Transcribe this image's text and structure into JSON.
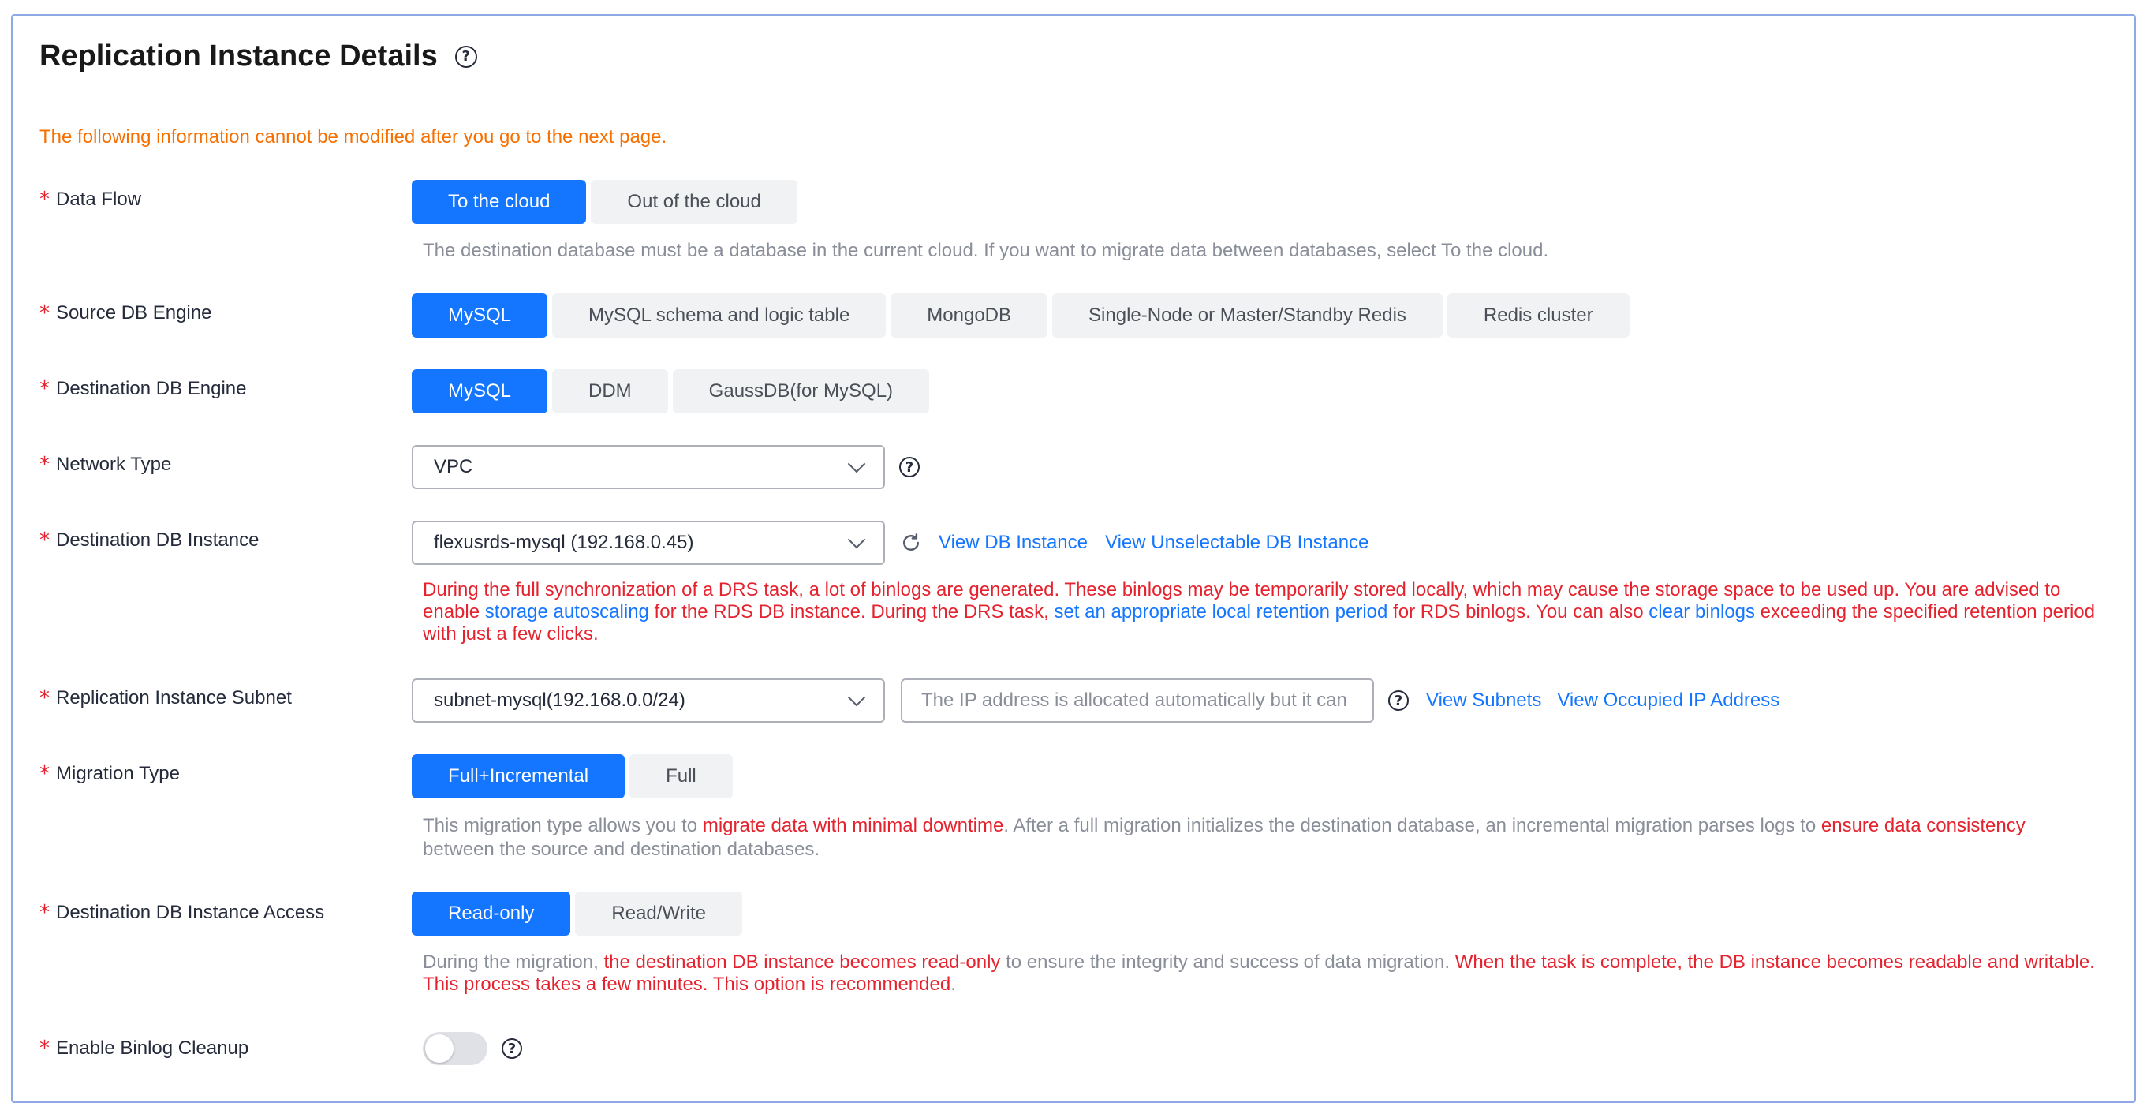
{
  "page": {
    "title": "Replication Instance Details",
    "notice": "The following information cannot be modified after you go to the next page."
  },
  "data_flow": {
    "label": "Data Flow",
    "options": [
      "To the cloud",
      "Out of the cloud"
    ],
    "selected": "To the cloud",
    "help": "The destination database must be a database in the current cloud. If you want to migrate data between databases, select To the cloud."
  },
  "source_engine": {
    "label": "Source DB Engine",
    "options": [
      "MySQL",
      "MySQL schema and logic table",
      "MongoDB",
      "Single-Node or Master/Standby Redis",
      "Redis cluster"
    ],
    "selected": "MySQL"
  },
  "dest_engine": {
    "label": "Destination DB Engine",
    "options": [
      "MySQL",
      "DDM",
      "GaussDB(for MySQL)"
    ],
    "selected": "MySQL"
  },
  "network_type": {
    "label": "Network Type",
    "value": "VPC"
  },
  "dest_instance": {
    "label": "Destination DB Instance",
    "value": "flexusrds-mysql (192.168.0.45)",
    "link_view": "View DB Instance",
    "link_unselectable": "View Unselectable DB Instance",
    "warning_1": "During the full synchronization of a DRS task, a lot of binlogs are generated. These binlogs may be temporarily stored locally, which may cause the storage space to be used up. You are advised to enable ",
    "warning_link_1": "storage autoscaling",
    "warning_2": " for the RDS DB instance. During the DRS task, ",
    "warning_link_2": "set an appropriate local retention period",
    "warning_3": " for RDS binlogs. You can also ",
    "warning_link_3": "clear binlogs",
    "warning_4": " exceeding the specified retention period with just a few clicks."
  },
  "subnet": {
    "label": "Replication Instance Subnet",
    "value": "subnet-mysql(192.168.0.0/24)",
    "ip_placeholder": "The IP address is allocated automatically but it can",
    "link_subnets": "View Subnets",
    "link_occupied": "View Occupied IP Address"
  },
  "migration_type": {
    "label": "Migration Type",
    "options": [
      "Full+Incremental",
      "Full"
    ],
    "selected": "Full+Incremental",
    "help_1": "This migration type allows you to ",
    "help_red_1": "migrate data with minimal downtime",
    "help_2": ". After a full migration initializes the destination database, an incremental migration parses logs to ",
    "help_red_2": "ensure data consistency",
    "help_3": "between the source and destination databases."
  },
  "dest_access": {
    "label": "Destination DB Instance Access",
    "options": [
      "Read-only",
      "Read/Write"
    ],
    "selected": "Read-only",
    "help_1": "During the migration, ",
    "help_red_1": "the destination DB instance becomes read-only",
    "help_2": " to ensure the integrity and success of data migration. ",
    "help_red_2": "When the task is complete, the DB instance becomes readable and writable. This process takes a few minutes. This option is recommended",
    "help_3": "."
  },
  "binlog_cleanup": {
    "label": "Enable Binlog Cleanup",
    "enabled": false
  },
  "colors": {
    "primary": "#1476ff",
    "required": "#e5232f",
    "notice": "#f66f00",
    "help": "#8a8e99",
    "border": "#8fa8e6"
  },
  "icons": {
    "required": "asterisk",
    "help": "question-circle-icon",
    "refresh": "refresh-icon",
    "dropdown": "chevron-down-icon"
  }
}
